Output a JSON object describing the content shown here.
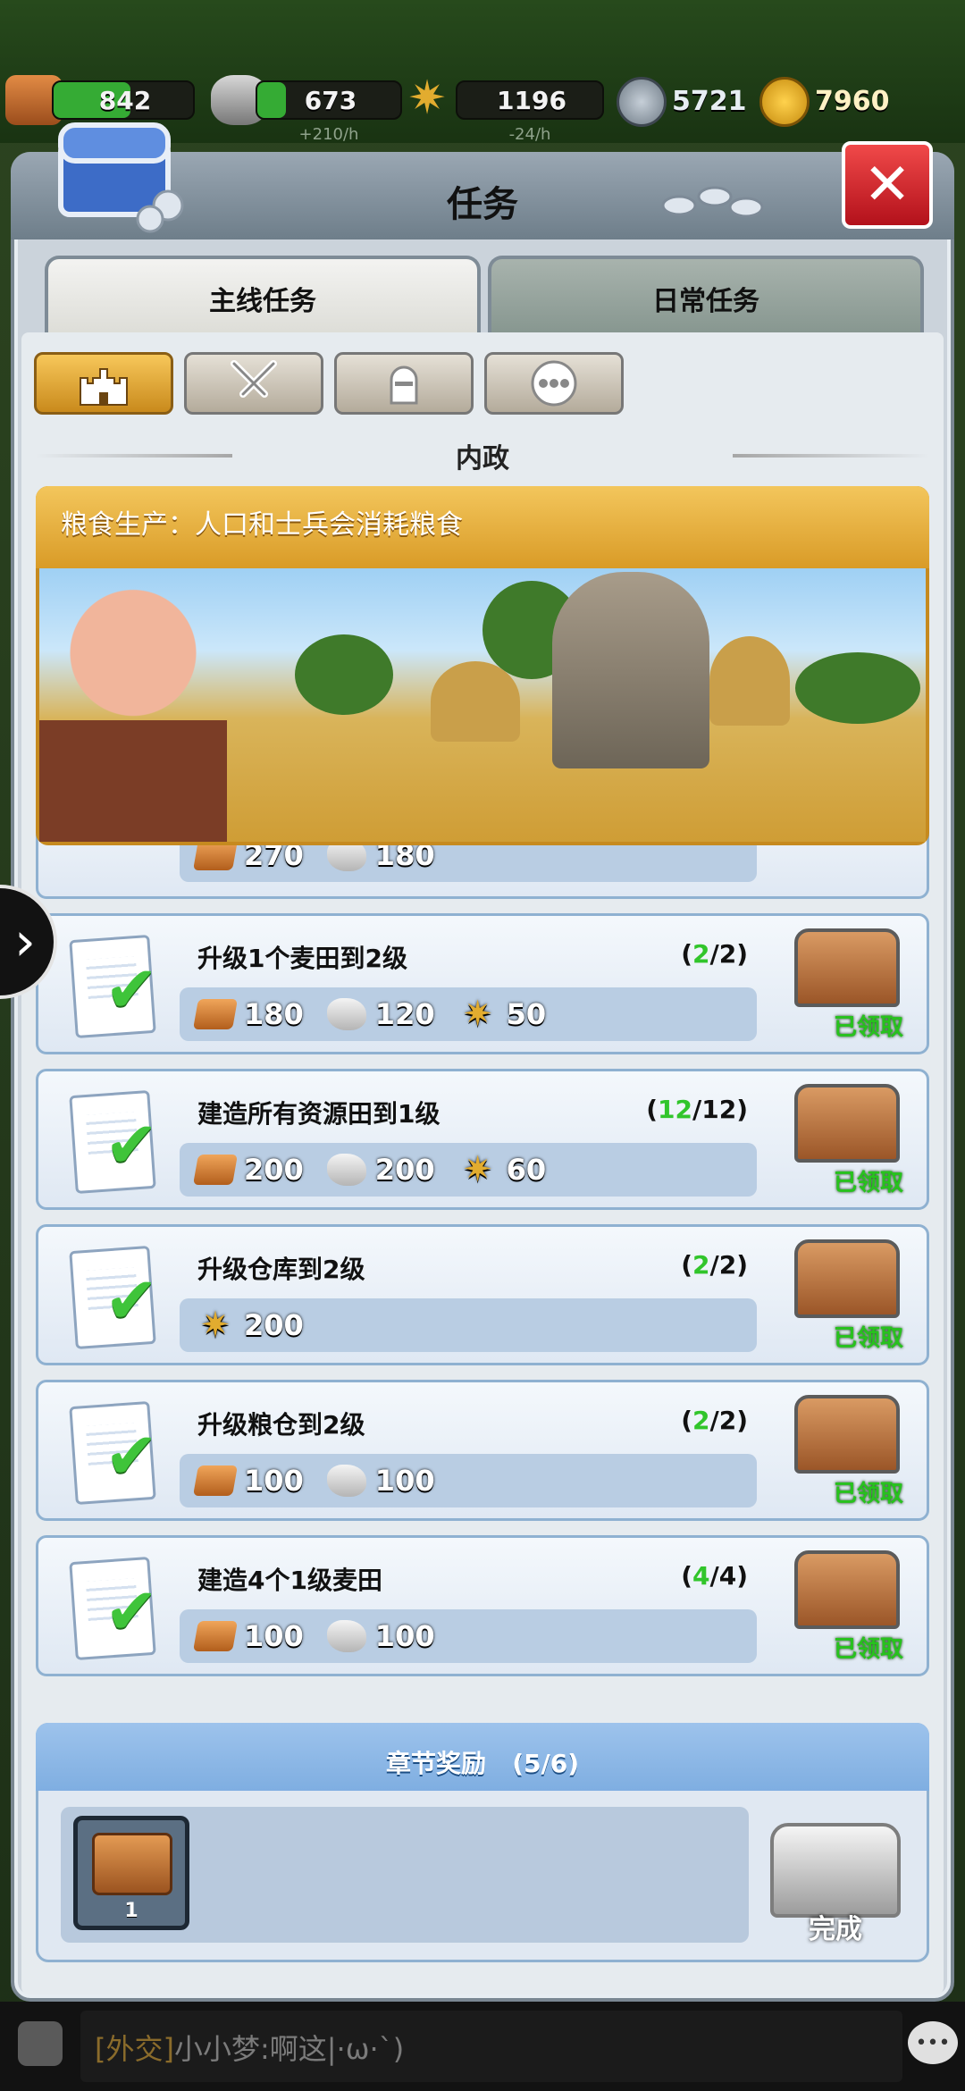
{
  "resources": [
    {
      "name": "wood",
      "value": "842",
      "rate": "",
      "fill": 0.55
    },
    {
      "name": "stone",
      "value": "673",
      "rate": "+210/h",
      "fill": 0.2
    },
    {
      "name": "wheat",
      "value": "1196",
      "rate": "-24/h",
      "fill": 0.0
    }
  ],
  "currency": {
    "silver": "5721",
    "gold": "7960"
  },
  "panel": {
    "title": "任务",
    "close_icon": "close-icon"
  },
  "tabs": {
    "main": "主线任务",
    "daily": "日常任务"
  },
  "categories": [
    {
      "icon": "castle-icon",
      "active": true
    },
    {
      "icon": "crossed-swords-icon",
      "active": false
    },
    {
      "icon": "knight-helmet-icon",
      "active": false
    },
    {
      "icon": "more-icon",
      "active": false
    }
  ],
  "section": "内政",
  "banner": {
    "text": "粮食生产：人口和士兵会消耗粮食"
  },
  "tasks": [
    {
      "name": "",
      "progress_done": "",
      "progress_total": "",
      "rewards": [
        {
          "type": "wood",
          "value": "270"
        },
        {
          "type": "stone",
          "value": "180"
        }
      ],
      "status": ""
    },
    {
      "name": "升级1个麦田到2级",
      "progress_done": "2",
      "progress_total": "2",
      "rewards": [
        {
          "type": "wood",
          "value": "180"
        },
        {
          "type": "stone",
          "value": "120"
        },
        {
          "type": "wheat",
          "value": "50"
        }
      ],
      "status": "已领取"
    },
    {
      "name": "建造所有资源田到1级",
      "progress_done": "12",
      "progress_total": "12",
      "rewards": [
        {
          "type": "wood",
          "value": "200"
        },
        {
          "type": "stone",
          "value": "200"
        },
        {
          "type": "wheat",
          "value": "60"
        }
      ],
      "status": "已领取"
    },
    {
      "name": "升级仓库到2级",
      "progress_done": "2",
      "progress_total": "2",
      "rewards": [
        {
          "type": "wheat",
          "value": "200"
        }
      ],
      "status": "已领取"
    },
    {
      "name": "升级粮仓到2级",
      "progress_done": "2",
      "progress_total": "2",
      "rewards": [
        {
          "type": "wood",
          "value": "100"
        },
        {
          "type": "stone",
          "value": "100"
        }
      ],
      "status": "已领取"
    },
    {
      "name": "建造4个1级麦田",
      "progress_done": "4",
      "progress_total": "4",
      "rewards": [
        {
          "type": "wood",
          "value": "100"
        },
        {
          "type": "stone",
          "value": "100"
        }
      ],
      "status": "已领取"
    }
  ],
  "chapter": {
    "title": "章节奖励",
    "progress": "(5/6)",
    "item_count": "1",
    "status": "完成"
  },
  "chat": {
    "channel": "[外交]",
    "message": "小小梦:啊这|·ω·`)"
  }
}
